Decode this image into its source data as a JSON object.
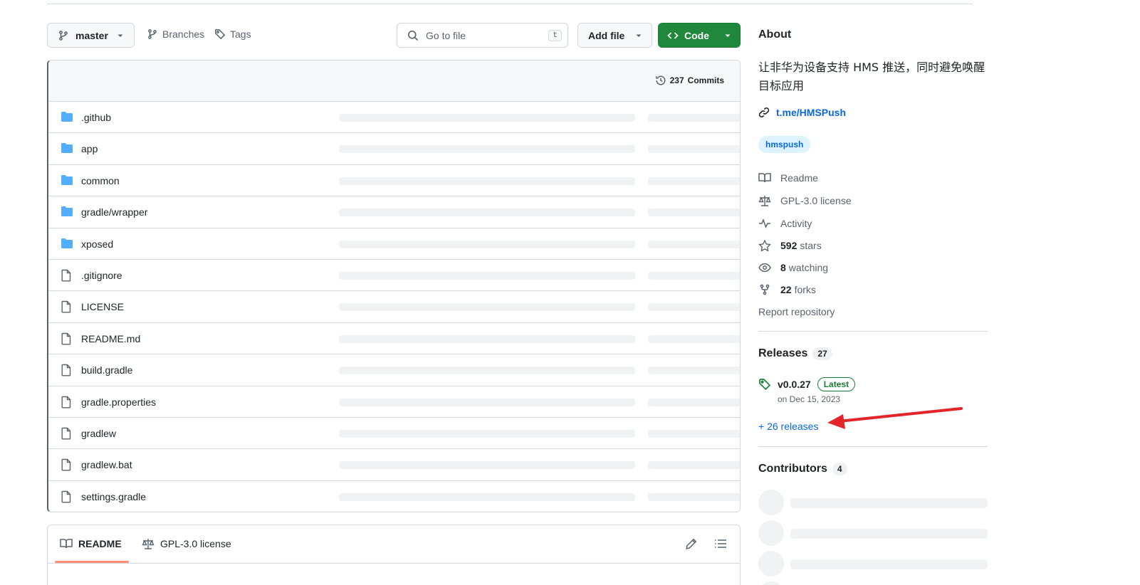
{
  "toolbar": {
    "branch": "master",
    "branches_label": "Branches",
    "tags_label": "Tags",
    "goto_placeholder": "Go to file",
    "goto_shortcut": "t",
    "add_file_label": "Add file",
    "code_label": "Code"
  },
  "files_header": {
    "commit_count": "237",
    "commit_label": "Commits"
  },
  "files": [
    {
      "name": ".github",
      "type": "folder"
    },
    {
      "name": "app",
      "type": "folder"
    },
    {
      "name": "common",
      "type": "folder"
    },
    {
      "name": "gradle/wrapper",
      "type": "folder"
    },
    {
      "name": "xposed",
      "type": "folder"
    },
    {
      "name": ".gitignore",
      "type": "file"
    },
    {
      "name": "LICENSE",
      "type": "file"
    },
    {
      "name": "README.md",
      "type": "file"
    },
    {
      "name": "build.gradle",
      "type": "file"
    },
    {
      "name": "gradle.properties",
      "type": "file"
    },
    {
      "name": "gradlew",
      "type": "file"
    },
    {
      "name": "gradlew.bat",
      "type": "file"
    },
    {
      "name": "settings.gradle",
      "type": "file"
    }
  ],
  "readme_tabs": {
    "readme": "README",
    "license": "GPL-3.0 license"
  },
  "about": {
    "title": "About",
    "description": "让非华为设备支持 HMS 推送，同时避免唤醒目标应用",
    "link": "t.me/HMSPush",
    "topic": "hmspush",
    "readme": "Readme",
    "license": "GPL-3.0 license",
    "activity": "Activity",
    "stars_count": "592",
    "stars_label": "stars",
    "watching_count": "8",
    "watching_label": "watching",
    "forks_count": "22",
    "forks_label": "forks",
    "report": "Report repository"
  },
  "releases": {
    "title": "Releases",
    "count": "27",
    "latest_name": "v0.0.27",
    "latest_badge": "Latest",
    "latest_date": "on Dec 15, 2023",
    "more": "+ 26 releases"
  },
  "contributors": {
    "title": "Contributors",
    "count": "4"
  },
  "colors": {
    "accent_link": "#0969da",
    "code_button": "#1f883d",
    "folder_icon": "#54aeff",
    "annotation_arrow": "#e5242a"
  }
}
